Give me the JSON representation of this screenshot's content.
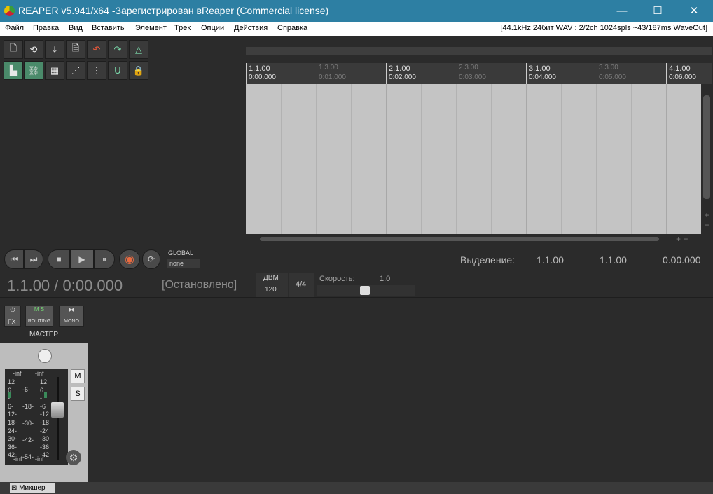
{
  "window": {
    "title": "REAPER v5.941/x64 -Зарегистрирован вReaper (Commercial license)",
    "minimize": "—",
    "maximize": "☐",
    "close": "✕"
  },
  "menu": {
    "items": [
      "Файл",
      "Правка",
      "Вид",
      "Вставить",
      "Элемент",
      "Трек",
      "Опции",
      "Действия",
      "Справка"
    ],
    "status": "[44.1kHz 24бит WAV : 2/2ch 1024spls ~43/187ms WaveOut]"
  },
  "ruler": {
    "bars": [
      "1.1.00",
      "2.1.00",
      "3.1.00",
      "4.1.00"
    ],
    "bar_times": [
      "0:00.000",
      "0:02.000",
      "0:04.000",
      "0:06.000"
    ],
    "beats": [
      "1.3.00",
      "2.3.00",
      "3.3.00"
    ],
    "beat_times": [
      "0:01.000",
      "0:03.000",
      "0:05.000"
    ]
  },
  "transport": {
    "global_label": "GLOBAL",
    "global_value": "none",
    "position": "1.1.00 / 0:00.000",
    "state": "[Остановлено]",
    "bpm_label": "ДВМ",
    "bpm_value": "120",
    "timesig": "4/4",
    "rate_label": "Скорость:",
    "rate_value": "1.0",
    "selection_label": "Выделение:",
    "sel_start": "1.1.00",
    "sel_end": "1.1.00",
    "sel_length": "0.00.000"
  },
  "mixer": {
    "fx_label": "FX",
    "routing_label": "ROUTING",
    "routing_ms": "M S",
    "mono_label": "MONO",
    "master_label": "МАСТЕР",
    "mute_label": "M",
    "solo_label": "S",
    "meter_top_left": "-inf",
    "meter_top_right": "-inf",
    "scale_left": [
      "12",
      "6",
      "-",
      "6-",
      "12-",
      "18-",
      "24-",
      "30-",
      "36-",
      "42-"
    ],
    "scale_mid": [
      "-6-",
      "-18-",
      "-30-",
      "-42-",
      "-54-"
    ],
    "scale_right": [
      "12",
      "6",
      "-",
      "-6",
      "-12",
      "-18",
      "-24",
      "-30",
      "-36",
      "-42"
    ],
    "meter_bottom_left": "-inf",
    "meter_bottom_right": "-inf",
    "tab_label": "Микшер"
  }
}
